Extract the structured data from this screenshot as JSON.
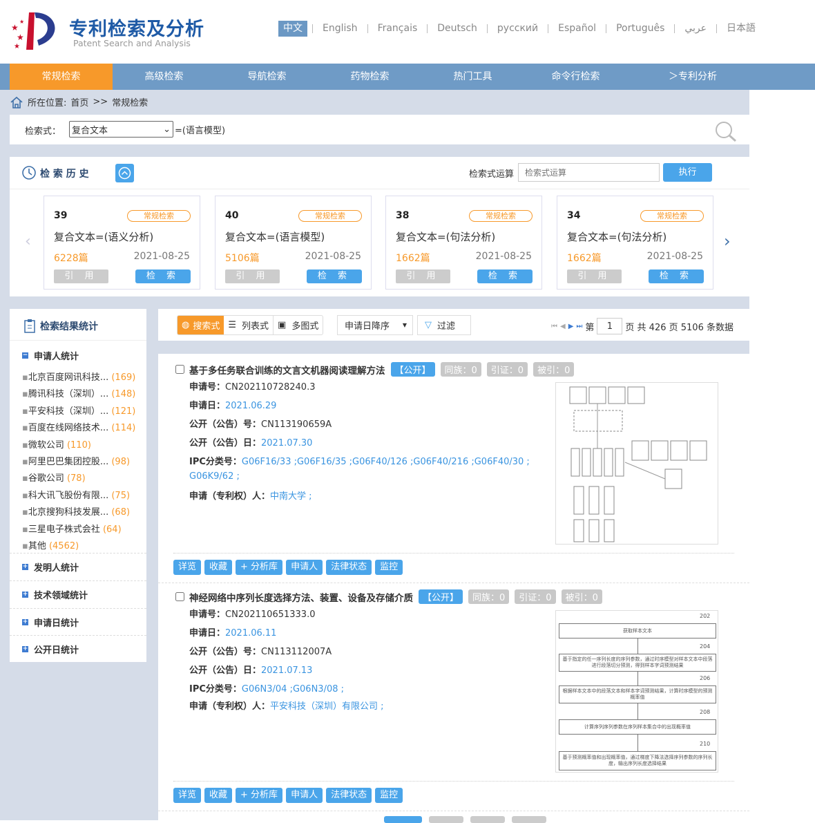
{
  "header": {
    "title": "专利检索及分析",
    "subtitle": "Patent Search and Analysis",
    "languages": [
      "中文",
      "English",
      "Français",
      "Deutsch",
      "русский",
      "Español",
      "Português",
      "عربي",
      "日本語"
    ]
  },
  "nav": {
    "tabs": [
      "常规检索",
      "高级检索",
      "导航检索",
      "药物检索",
      "热门工具",
      "命令行检索",
      "＞专利分析"
    ],
    "active": 0
  },
  "breadcrumb": {
    "label": "所在位置:",
    "home": "首页",
    "sep": ">>",
    "current": "常规检索"
  },
  "search": {
    "label": "检索式：",
    "field": "复合文本",
    "expr": "=(语言模型)"
  },
  "history": {
    "title": "检 索 历 史",
    "expr_label": "检索式运算",
    "expr_placeholder": "检索式运算",
    "run": "执行",
    "cards": [
      {
        "num": "39",
        "tag": "常规检索",
        "query": "复合文本=(语义分析)",
        "count": "6228篇",
        "date": "2021-08-25",
        "cite": "引 用",
        "search": "检 索"
      },
      {
        "num": "40",
        "tag": "常规检索",
        "query": "复合文本=(语言模型)",
        "count": "5106篇",
        "date": "2021-08-25",
        "cite": "引 用",
        "search": "检 索"
      },
      {
        "num": "38",
        "tag": "常规检索",
        "query": "复合文本=(句法分析)",
        "count": "1662篇",
        "date": "2021-08-25",
        "cite": "引 用",
        "search": "检 索"
      },
      {
        "num": "34",
        "tag": "常规检索",
        "query": "复合文本=(句法分析)",
        "count": "1662篇",
        "date": "2021-08-25",
        "cite": "引 用",
        "search": "检 索"
      }
    ]
  },
  "stats": {
    "title": "检索结果统计",
    "applicant_title": "申请人统计",
    "applicants": [
      {
        "name": "北京百度网讯科技...",
        "count": "(169)"
      },
      {
        "name": "腾讯科技（深圳）...",
        "count": "(148)"
      },
      {
        "name": "平安科技（深圳）...",
        "count": "(121)"
      },
      {
        "name": "百度在线网络技术...",
        "count": "(114)"
      },
      {
        "name": "微软公司",
        "count": "(110)"
      },
      {
        "name": "阿里巴巴集团控股...",
        "count": "(98)"
      },
      {
        "name": "谷歌公司",
        "count": "(78)"
      },
      {
        "name": "科大讯飞股份有限...",
        "count": "(75)"
      },
      {
        "name": "北京搜狗科技发展...",
        "count": "(68)"
      },
      {
        "name": "三星电子株式会社",
        "count": "(64)"
      },
      {
        "name": "其他",
        "count": "(4562)"
      }
    ],
    "sections": [
      "发明人统计",
      "技术领域统计",
      "申请日统计",
      "公开日统计"
    ]
  },
  "toolbar": {
    "views": [
      "搜索式",
      "列表式",
      "多图式"
    ],
    "sort": "申请日降序",
    "filter": "过滤",
    "page_prefix": "第",
    "page": "1",
    "page_suffix": "页 共 426 页 5106 条数据"
  },
  "labels": {
    "app_no": "申请号：",
    "app_date": "申请日：",
    "pub_no": "公开（公告）号：",
    "pub_date": "公开（公告）日：",
    "ipc": "IPC分类号：",
    "applicant": "申请（专利权）人："
  },
  "actions": [
    "详览",
    "收藏",
    "+ 分析库",
    "申请人",
    "法律状态",
    "监控"
  ],
  "results": [
    {
      "title": "基于多任务联合训练的文言文机器阅读理解方法",
      "status": "【公开】",
      "family": "同族：0",
      "cites": "引证：0",
      "cited": "被引：0",
      "app_no": "CN202110728240.3",
      "app_date": "2021.06.29",
      "pub_no": "CN113190659A",
      "pub_date": "2021.07.30",
      "ipc_line1": "G06F16/33 ;G06F16/35 ;G06F40/126 ;G06F40/216 ;G06F40/30 ;",
      "ipc_line2": "G06K9/62 ;",
      "applicant": "中南大学 ;"
    },
    {
      "title": "神经网络中序列长度选择方法、装置、设备及存储介质",
      "status": "【公开】",
      "family": "同族：0",
      "cites": "引证：0",
      "cited": "被引：0",
      "app_no": "CN202110651333.0",
      "app_date": "2021.06.11",
      "pub_no": "CN113112007A",
      "pub_date": "2021.07.13",
      "ipc_line1": "G06N3/04 ;G06N3/08 ;",
      "applicant": "平安科技（深圳）有限公司 ;",
      "figure": {
        "steps": [
          {
            "n": "202",
            "t": "获取样本文本"
          },
          {
            "n": "204",
            "t": "基于指定的任一序列长度的序列参数，通过时序模型对样本文本中段落进行段落切分预测，得到样本字词预测结果"
          },
          {
            "n": "206",
            "t": "根据样本文本中的段落文本和样本字词预测结果，计算时序模型的预测概率值"
          },
          {
            "n": "208",
            "t": "计算序列序列参数在序列样本集合中的出现概率值"
          },
          {
            "n": "210",
            "t": "基于预测概率值和出现概率值，通过梯度下降法选择序列参数的序列长度，输出序列长度选择结果"
          }
        ]
      }
    }
  ],
  "colors": {
    "accent": "#f7992a",
    "nav": "#6f9bc6",
    "primary": "#4aa5ea",
    "link": "#3a94e0",
    "bg": "#d5dce8"
  }
}
